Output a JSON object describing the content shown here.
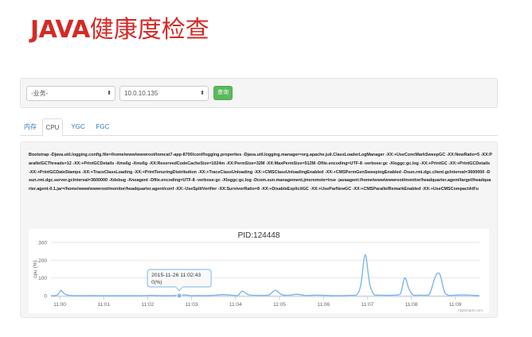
{
  "slide": {
    "title_latin": "JAVA",
    "title_cn": "健康度检查"
  },
  "toolbar": {
    "business_select": {
      "value": "-业务-",
      "caret": "⬍"
    },
    "ip_select": {
      "value": "10.0.10.135",
      "caret": "⬍"
    },
    "query_label": "查询"
  },
  "tabs": [
    {
      "label": "内存",
      "active": false
    },
    {
      "label": "CPU",
      "active": true
    },
    {
      "label": "YGC",
      "active": false
    },
    {
      "label": "FGC",
      "active": false
    }
  ],
  "jvm_args": "Bootstrap -Djava.util.logging.config.file=/home/www/wwwroot/tomcat7-app-8700/conf/logging.properties -Djava.util.logging.manager=org.apache.juli.ClassLoaderLogManager -XX:+UseConcMarkSweepGC -XX:NewRatio=5 -XX:ParallelGCThreads=12 -XX:+PrintGCDetails -Xms6g -Xmx6g -XX:ReservedCodeCacheSize=1024m -XX:PermSize=32M -XX:MaxPermSize=512M -Dfile.encoding=UTF-8 -verbose:gc -Xloggc:gc.log -XX:+PrintGC -XX:+PrintGCDetails -XX:+PrintGCDateStamps -XX:+TraceClassLoading -XX:+PrintTenuringDistribution -XX:+TraceClassUnloading -XX:+CMSClassUnloadingEnabled -XX:+CMSPermGenSweepingEnabled -Dsun.rmi.dgc.client.gcInterval=3600000 -Dsun.rmi.dgc.server.gcInterval=3600000 -Xdebug -Xnoagent -Dfile.encoding=UTF-8 -verbose:gc -Xloggc:gc.log -Dcom.sun.management.jmxremote=true -javaagent:/home/www/wwwroot/monitor/headquarter.agent/target/headquarter.agent-0.1.jar=/home/www/wwwroot/monitor/headquarter.agent/conf -XX:-UseSplitVerifier -XX:SurvivorRatio=8 -XX:+DisableExplicitGC -XX:+UseParNewGC -XX:+CMSParallelRemarkEnabled -XX:+UseCMSCompactAtFu",
  "chart_data": {
    "type": "line",
    "title": "PID:124448",
    "xlabel": "",
    "ylabel": "cpu (%)",
    "ylim": [
      0,
      300
    ],
    "yticks": [
      0,
      100,
      200,
      300
    ],
    "x_ticks": [
      "11:00",
      "11:01",
      "11:02",
      "11:03",
      "11:04",
      "11:05",
      "11:06",
      "11:07",
      "11:08",
      "11:09"
    ],
    "xlim": [
      -0.2,
      9.55
    ],
    "grid": true,
    "credits": "Highcharts.com",
    "colors": {
      "line": "#7cb5ec",
      "grid": "#e6e6e6",
      "axis_text": "#666666"
    },
    "series": [
      {
        "x": [
          -0.2,
          -0.12,
          -0.05,
          0.0,
          0.03,
          0.1,
          0.2,
          0.4,
          0.7,
          0.9,
          1.1,
          1.3,
          1.5,
          1.7,
          1.9,
          2.1,
          2.3,
          2.5,
          2.7,
          2.85,
          2.92,
          3.0,
          3.1,
          3.3,
          3.5,
          3.7,
          3.9,
          4.05,
          4.15,
          4.3,
          4.5,
          4.75,
          4.9,
          5.05,
          5.2,
          5.4,
          5.6,
          5.8,
          6.0,
          6.2,
          6.4,
          6.6,
          6.75,
          6.85,
          6.95,
          7.05,
          7.15,
          7.25,
          7.4,
          7.6,
          7.75,
          7.85,
          7.95,
          8.05,
          8.2,
          8.4,
          8.55,
          8.65,
          8.75,
          8.85,
          9.0,
          9.2,
          9.4,
          9.55
        ],
        "y": [
          0,
          0,
          5,
          20,
          30,
          12,
          2,
          0,
          1,
          0,
          0,
          0,
          0,
          0,
          0,
          2,
          0,
          0,
          2,
          4,
          2,
          0,
          1,
          0,
          2,
          6,
          3,
          0,
          25,
          5,
          2,
          3,
          30,
          6,
          2,
          8,
          1,
          3,
          2,
          0,
          0,
          2,
          4,
          60,
          230,
          70,
          6,
          3,
          2,
          3,
          10,
          100,
          35,
          3,
          3,
          4,
          110,
          120,
          25,
          2,
          3,
          4,
          2,
          0
        ]
      }
    ],
    "tooltip": {
      "line1": "2015-11-26 11:02:43",
      "line2": "0(%)",
      "x": 2.72,
      "y": 0
    }
  }
}
